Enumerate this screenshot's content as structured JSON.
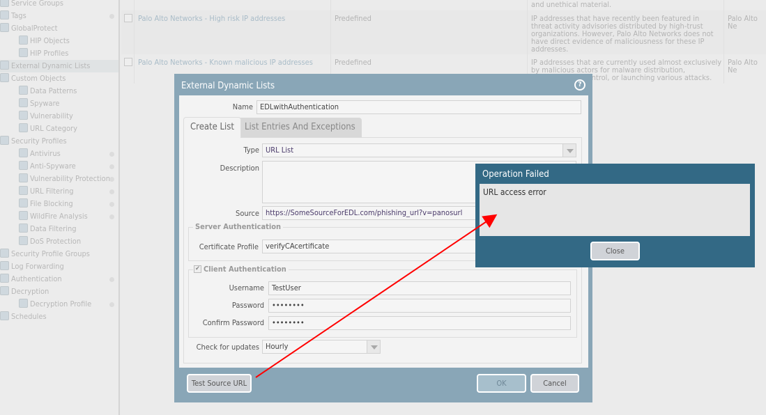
{
  "sidebar": {
    "items": [
      {
        "label": "Service Groups",
        "level": 0,
        "icon": "service-groups-icon"
      },
      {
        "label": "Tags",
        "level": 0,
        "icon": "tag-icon",
        "dot": true
      },
      {
        "label": "GlobalProtect",
        "level": 0,
        "icon": "globalprotect-icon"
      },
      {
        "label": "HIP Objects",
        "level": 1,
        "icon": "hip-objects-icon"
      },
      {
        "label": "HIP Profiles",
        "level": 1,
        "icon": "hip-profiles-icon"
      },
      {
        "label": "External Dynamic Lists",
        "level": 0,
        "icon": "list-icon",
        "selected": true
      },
      {
        "label": "Custom Objects",
        "level": 0,
        "icon": "custom-objects-icon"
      },
      {
        "label": "Data Patterns",
        "level": 1,
        "icon": "document-icon"
      },
      {
        "label": "Spyware",
        "level": 1,
        "icon": "magnifier-icon"
      },
      {
        "label": "Vulnerability",
        "level": 1,
        "icon": "shield-icon"
      },
      {
        "label": "URL Category",
        "level": 1,
        "icon": "globe-shield-icon"
      },
      {
        "label": "Security Profiles",
        "level": 0,
        "icon": "security-profiles-icon"
      },
      {
        "label": "Antivirus",
        "level": 1,
        "icon": "bug-icon",
        "dot": true
      },
      {
        "label": "Anti-Spyware",
        "level": 1,
        "icon": "magnifier-icon",
        "dot": true
      },
      {
        "label": "Vulnerability Protection",
        "level": 1,
        "icon": "shield-icon",
        "dot": true
      },
      {
        "label": "URL Filtering",
        "level": 1,
        "icon": "globe-shield-icon",
        "dot": true
      },
      {
        "label": "File Blocking",
        "level": 1,
        "icon": "file-shield-icon",
        "dot": true
      },
      {
        "label": "WildFire Analysis",
        "level": 1,
        "icon": "wildfire-icon",
        "dot": true
      },
      {
        "label": "Data Filtering",
        "level": 1,
        "icon": "data-filtering-icon"
      },
      {
        "label": "DoS Protection",
        "level": 1,
        "icon": "dos-icon"
      },
      {
        "label": "Security Profile Groups",
        "level": 0,
        "icon": "profile-groups-icon"
      },
      {
        "label": "Log Forwarding",
        "level": 0,
        "icon": "log-forwarding-icon"
      },
      {
        "label": "Authentication",
        "level": 0,
        "icon": "authentication-icon",
        "dot": true
      },
      {
        "label": "Decryption",
        "level": 0,
        "icon": "lock-icon"
      },
      {
        "label": "Decryption Profile",
        "level": 1,
        "icon": "key-icon",
        "dot": true
      },
      {
        "label": "Schedules",
        "level": 0,
        "icon": "calendar-icon"
      }
    ]
  },
  "table": {
    "partial_desc": "and unethical material.",
    "rows": [
      {
        "name": "Palo Alto Networks - High risk IP addresses",
        "type": "Predefined",
        "description": "IP addresses that have recently been featured in threat activity advisories distributed by high-trust organizations. However, Palo Alto Networks does not have direct evidence of maliciousness for these IP addresses.",
        "source": "Palo Alto Ne"
      },
      {
        "name": "Palo Alto Networks - Known malicious IP addresses",
        "type": "Predefined",
        "description": "IP addresses that are currently used almost exclusively by malicious actors for malware distribution, command-and-control, or launching various attacks.",
        "source": "Palo Alto Ne"
      }
    ]
  },
  "dialog": {
    "title": "External Dynamic Lists",
    "name_label": "Name",
    "name_value": "EDLwithAuthentication",
    "tabs": [
      "Create List",
      "List Entries And Exceptions"
    ],
    "type_label": "Type",
    "type_value": "URL List",
    "description_label": "Description",
    "description_value": "",
    "source_label": "Source",
    "source_value": "https://SomeSourceForEDL.com/phishing_url?v=panosurl",
    "server_auth": "Server Authentication",
    "cert_label": "Certificate Profile",
    "cert_value": "verifyCAcertificate",
    "client_auth": "Client Authentication",
    "client_auth_checked": true,
    "username_label": "Username",
    "username_value": "TestUser",
    "password_label": "Password",
    "password_value": "••••••••",
    "confirm_label": "Confirm Password",
    "confirm_value": "••••••••",
    "updates_label": "Check for updates",
    "updates_value": "Hourly",
    "test_button": "Test Source URL",
    "ok_button": "OK",
    "cancel_button": "Cancel"
  },
  "error_dialog": {
    "title": "Operation Failed",
    "message": "URL access error",
    "close_button": "Close"
  },
  "colors": {
    "dialog_frame": "#89a6b7",
    "error_frame": "#336985",
    "annotation_arrow": "#ff0000"
  }
}
